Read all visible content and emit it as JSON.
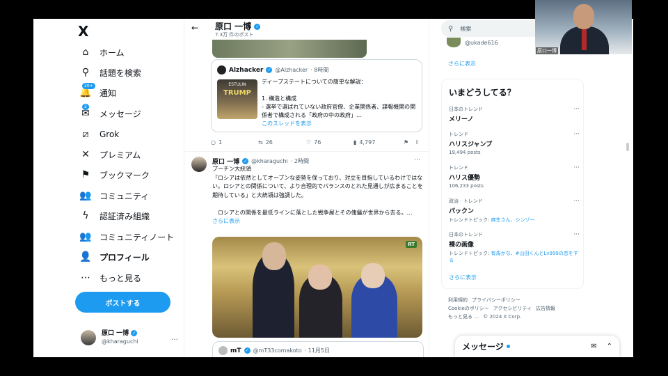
{
  "sidebar": {
    "logo": "X",
    "items": [
      {
        "label": "ホーム",
        "icon": "home-icon",
        "glyph": "⌂"
      },
      {
        "label": "話題を検索",
        "icon": "search-icon",
        "glyph": "⚲"
      },
      {
        "label": "通知",
        "icon": "bell-icon",
        "glyph": "🔔",
        "badge": "20+"
      },
      {
        "label": "メッセージ",
        "icon": "mail-icon",
        "glyph": "✉",
        "badge": "2"
      },
      {
        "label": "Grok",
        "icon": "grok-icon",
        "glyph": "⧄"
      },
      {
        "label": "プレミアム",
        "icon": "x-premium-icon",
        "glyph": "✕"
      },
      {
        "label": "ブックマーク",
        "icon": "bookmark-icon",
        "glyph": "⚑"
      },
      {
        "label": "コミュニティ",
        "icon": "communities-icon",
        "glyph": "👥"
      },
      {
        "label": "認証済み組織",
        "icon": "lightning-icon",
        "glyph": "ϟ"
      },
      {
        "label": "コミュニティノート",
        "icon": "community-notes-icon",
        "glyph": "👥"
      },
      {
        "label": "プロフィール",
        "icon": "profile-icon",
        "glyph": "👤"
      },
      {
        "label": "もっと見る",
        "icon": "more-circle-icon",
        "glyph": "⋯"
      }
    ],
    "post_button": "ポストする",
    "account": {
      "name": "原口 一博",
      "handle": "@kharaguchi",
      "more": "…"
    }
  },
  "main": {
    "back": "←",
    "title": "原口 一博",
    "post_count": "7.3万 件のポスト",
    "quote1": {
      "name": "Alzhacker",
      "handle": "@Alzhacker",
      "time": "· 8時間",
      "book_author": "ESTULIN",
      "book_title": "TRUMP",
      "text": "ディープステートについての簡単な解説：\n\n1. 構造と構成\n- 選挙で選ばれていない政府官僚、企業関係者、諜報機関の関係者で構成される「政府の中の政府」…",
      "thread_link": "このスレッドを表示"
    },
    "actions": {
      "reply": "1",
      "repost": "26",
      "like": "76",
      "views": "4,797"
    },
    "tweet2": {
      "name": "原口 一博",
      "handle": "@kharaguchi",
      "time": "· 2時間",
      "more": "···",
      "text": "プーチン大統領\n「ロシアは依然としてオープンな姿勢を保っており、対立を目指しているわけではない。ロシアとの関係について、より合理的でバランスのとれた見通しが広まることを期待している」と大統領は強調した。\n\n　ロシアとの関係を最低ラインに落とした戦争屋とその傀儡が世界から去る。…",
      "show_more": "さらに表示",
      "media_badge": "RT"
    },
    "quote2": {
      "name": "mT",
      "handle": "@mT33comakoto",
      "time": "· 11月5日"
    }
  },
  "right": {
    "search_placeholder": "検索",
    "who_handle": "@ukade616",
    "show_more": "さらに表示",
    "trends_title": "いまどうしてる？",
    "trends": [
      {
        "context": "日本のトレンド",
        "name": "メリーノ",
        "posts": ""
      },
      {
        "context": "トレンド",
        "name": "ハリスジャンプ",
        "posts": "19,494 posts"
      },
      {
        "context": "トレンド",
        "name": "ハリス優勢",
        "posts": "106,233 posts"
      },
      {
        "context": "政治 · トレンド",
        "name": "パックン",
        "posts": "トレンドトピック: ",
        "topics": "麻生さん、シンゾー"
      },
      {
        "context": "日本のトレンド",
        "name": "裸の画像",
        "posts": "トレンドトピック: ",
        "topics": "有馬かな、#山田くんとLv999の恋をする"
      }
    ],
    "trends_more": "さらに表示",
    "footer": [
      "利用規約",
      "プライバシーポリシー",
      "Cookieのポリシー",
      "アクセシビリティ",
      "広告情報",
      "もっと見る …",
      "© 2024 X Corp."
    ],
    "messages": "メッセージ"
  },
  "camera": {
    "label": "原口一博"
  },
  "colors": {
    "accent": "#1d9bf0",
    "text": "#0f1419",
    "muted": "#536471"
  }
}
